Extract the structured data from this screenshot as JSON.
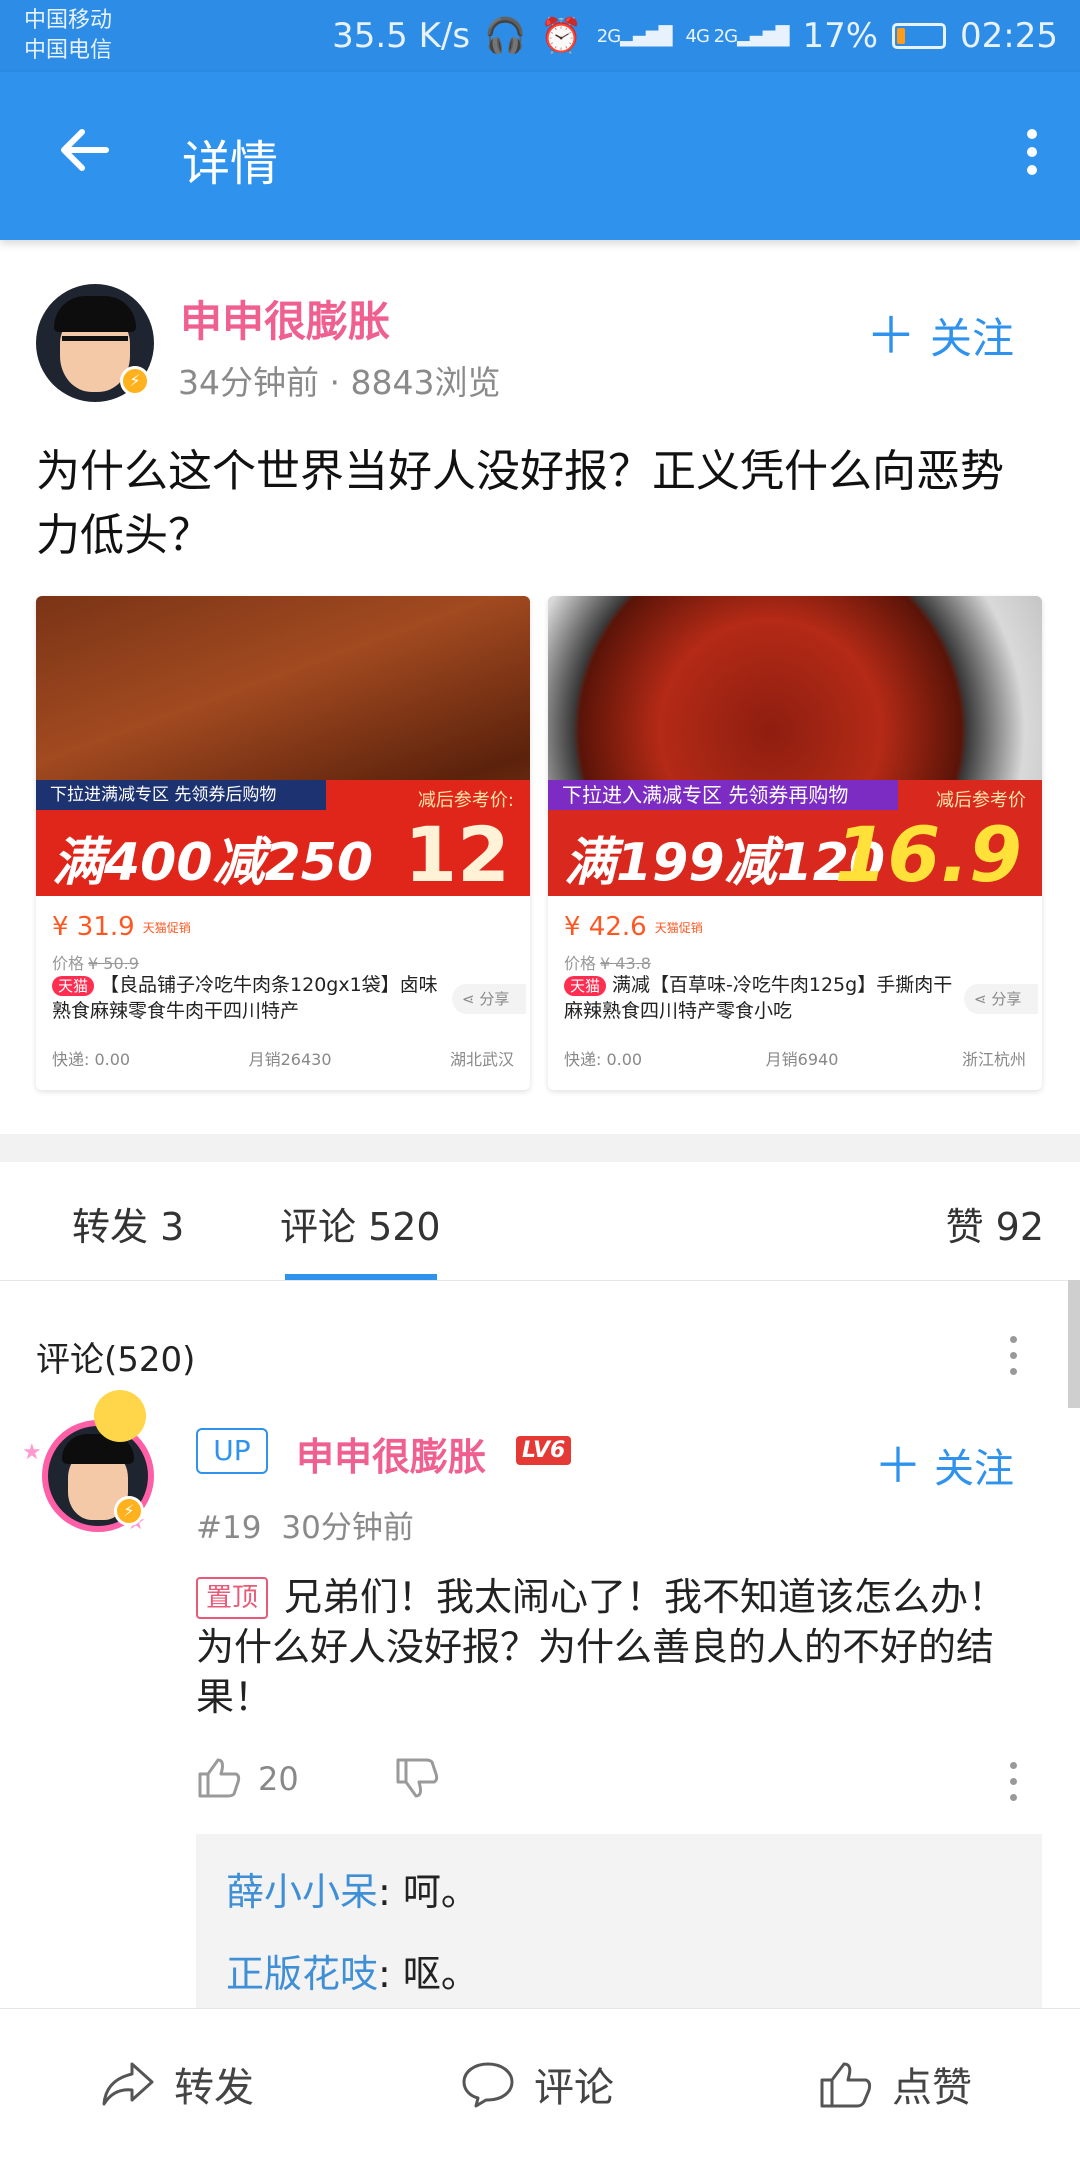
{
  "status_bar": {
    "carrier_1": "中国移动",
    "carrier_2": "中国电信",
    "speed": "35.5 K/s",
    "network_1": "2G",
    "network_2": "4G 2G",
    "battery": "17%",
    "time": "02:25"
  },
  "app_bar": {
    "title": "详情"
  },
  "post": {
    "author": "申申很膨胀",
    "meta": "34分钟前 · 8843浏览",
    "follow_label": "关注",
    "title": "为什么这个世界当好人没好报？正义凭什么向恶势力低头？"
  },
  "products": [
    {
      "promo_top": "下拉进满减专区 先领券后购物",
      "promo_main": "满400减250",
      "promo_ref": "减后参考价:",
      "promo_price": "12",
      "price": "¥ 31.9",
      "price_tag": "天猫促销",
      "orig_label": "价格",
      "orig_price": "¥ 50.9",
      "mall_tag": "天猫",
      "description": "【良品铺子冷吃牛肉条120gx1袋】卤味熟食麻辣零食牛肉干四川特产",
      "share": "分享",
      "shipping": "快递: 0.00",
      "monthly_sales": "月销26430",
      "location": "湖北武汉"
    },
    {
      "promo_top": "下拉进入满减专区 先领券再购物",
      "promo_main": "满199减120",
      "promo_ref": "减后参考价",
      "promo_price": "16.9",
      "price": "¥ 42.6",
      "price_tag": "天猫促销",
      "orig_label": "价格",
      "orig_price": "¥ 43.8",
      "mall_tag": "天猫",
      "description": "满减【百草味-冷吃牛肉125g】手撕肉干麻辣熟食四川特产零食小吃",
      "share": "分享",
      "shipping": "快递: 0.00",
      "monthly_sales": "月销6940",
      "location": "浙江杭州"
    }
  ],
  "tabs": {
    "forward": "转发 3",
    "comment": "评论 520",
    "like": "赞 92"
  },
  "comments": {
    "header": "评论(520)",
    "items": [
      {
        "up_tag": "UP",
        "author": "申申很膨胀",
        "level": "LV6",
        "follow_label": "关注",
        "floor": "#19",
        "time": "30分钟前",
        "pin_tag": "置顶",
        "text": "兄弟们！我太闹心了！我不知道该怎么办！为什么好人没好报？为什么善良的人的不好的结果！",
        "likes": "20",
        "replies": [
          {
            "name": "薛小小呆",
            "text": ": 呵。"
          },
          {
            "name": "正版花吱",
            "text": ": 呕。"
          }
        ]
      }
    ]
  },
  "bottom_bar": {
    "forward": "转发",
    "comment": "评论",
    "like": "点赞"
  },
  "colors": {
    "accent": "#2f93ee",
    "username": "#ef5f8f",
    "price": "#ff5722"
  }
}
